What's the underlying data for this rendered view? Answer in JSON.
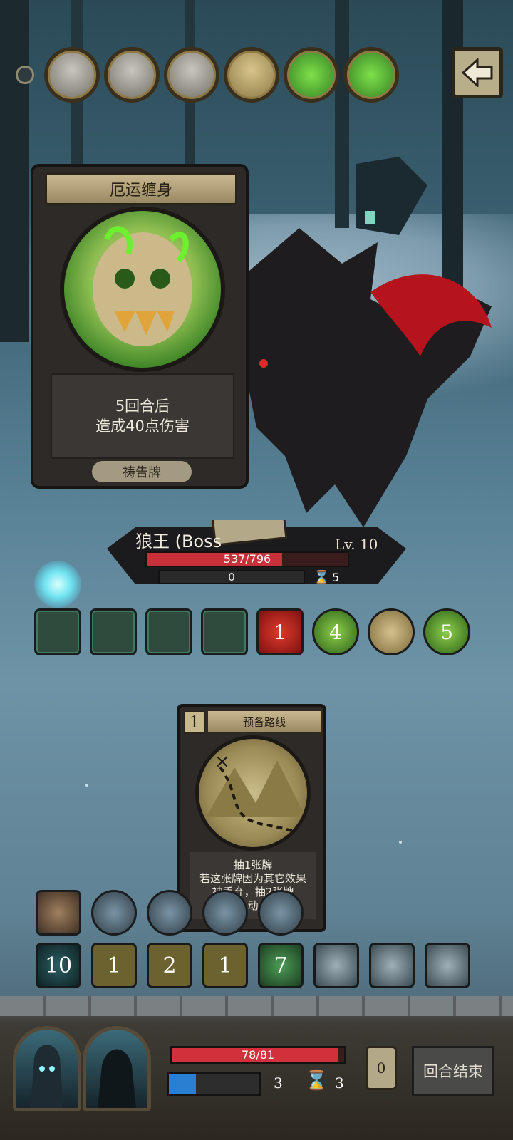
{
  "top_portraits": [
    {
      "name": "plague-doctor-portrait",
      "style": "grey"
    },
    {
      "name": "knight-portrait",
      "style": "grey"
    },
    {
      "name": "hunter-portrait",
      "style": "grey"
    },
    {
      "name": "axe-portrait",
      "style": "tan"
    },
    {
      "name": "cursed-skull-portrait",
      "style": "green"
    },
    {
      "name": "cursed-skull-portrait-2",
      "style": "green"
    }
  ],
  "boss_card": {
    "title": "厄运缠身",
    "desc_line1": "5回合后",
    "desc_line2": "造成40点伤害",
    "type": "祷告牌"
  },
  "boss": {
    "name": "狼王 (Boss",
    "level": "Lv. 10",
    "hp_text": "537/796",
    "hp_current": 537,
    "hp_max": 796,
    "armor_text": "0",
    "turns": "5"
  },
  "status_effects": [
    {
      "name": "spider-eye-effect",
      "shape": "sq",
      "label": ""
    },
    {
      "name": "spellbook-effect",
      "shape": "sq",
      "label": ""
    },
    {
      "name": "hooded-figure-effect",
      "shape": "sq",
      "label": ""
    },
    {
      "name": "old-man-effect",
      "shape": "sq",
      "label": ""
    },
    {
      "name": "blood-effect",
      "shape": "red",
      "label": "1"
    },
    {
      "name": "curse-effect",
      "shape": "rnd",
      "label": "4"
    },
    {
      "name": "axe-effect",
      "shape": "rnd tan",
      "label": ""
    },
    {
      "name": "curse-effect-2",
      "shape": "rnd",
      "label": "5"
    }
  ],
  "hand_card": {
    "cost": "1",
    "title": "预备路线",
    "desc_line1": "抽1张牌",
    "desc_line2": "若这张牌因为其它效果",
    "desc_line3": "被丢弃，抽2张牌",
    "desc_line4": "动"
  },
  "relics": [
    {
      "name": "gun-relic",
      "shape": "sq"
    },
    {
      "name": "bat-relic",
      "shape": "rnd"
    },
    {
      "name": "lightning-relic",
      "shape": "rnd"
    },
    {
      "name": "slingshot-relic",
      "shape": "rnd"
    },
    {
      "name": "hood-relic",
      "shape": "rnd"
    }
  ],
  "effects": [
    {
      "name": "shield-effect",
      "style": "teal",
      "label": "10"
    },
    {
      "name": "boot-effect",
      "style": "boot",
      "label": "1"
    },
    {
      "name": "boot-effect-2",
      "style": "boot",
      "label": "2"
    },
    {
      "name": "boot-effect-3",
      "style": "boot",
      "label": "1"
    },
    {
      "name": "poison-effect",
      "style": "green",
      "label": "7"
    },
    {
      "name": "dancer-effect",
      "style": "pic",
      "label": ""
    },
    {
      "name": "flame-feather-effect",
      "style": "pic",
      "label": ""
    },
    {
      "name": "scholar-effect",
      "style": "pic",
      "label": ""
    }
  ],
  "player": {
    "hp_text": "78/81",
    "hp_current": 78,
    "hp_max": 81,
    "mana_fraction": 0.3,
    "mana": "3",
    "turn": "3",
    "deck_count": "0",
    "end_turn_label": "回合结束"
  },
  "colors": {
    "hp_red": "#c8313a",
    "mana_blue": "#2b7fd2",
    "curse_green": "#7fe04a",
    "parchment": "#c9b88f"
  }
}
